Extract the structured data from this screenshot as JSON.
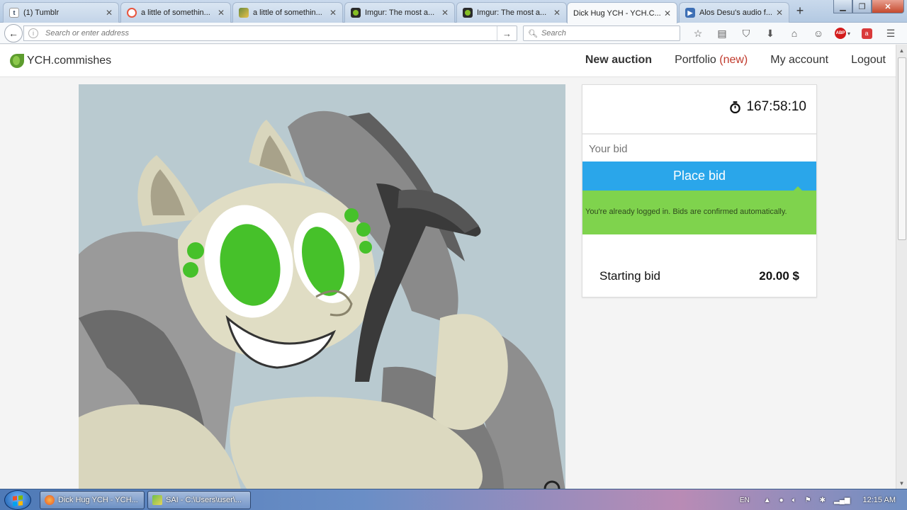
{
  "browser": {
    "tabs": [
      {
        "title": "(1) Tumblr",
        "icon": "tumblr-icon",
        "active": false
      },
      {
        "title": "a little of somethin...",
        "icon": "patreon-icon",
        "active": false
      },
      {
        "title": "a little of somethin...",
        "icon": "artwork-thumb-icon",
        "active": false
      },
      {
        "title": "Imgur: The most a...",
        "icon": "imgur-icon",
        "active": false
      },
      {
        "title": "Imgur: The most a...",
        "icon": "imgur-icon",
        "active": false
      },
      {
        "title": "Dick Hug YCH - YCH.C...",
        "icon": "none",
        "active": true
      },
      {
        "title": "Alos Desu's audio f...",
        "icon": "audio-play-icon",
        "active": false
      }
    ],
    "new_tab": "+",
    "address_placeholder": "Search or enter address",
    "search_placeholder": "Search"
  },
  "site": {
    "logo_text": "YCH.commishes",
    "nav": {
      "new_auction": "New auction",
      "portfolio": "Portfolio",
      "portfolio_badge": "(new)",
      "my_account": "My account",
      "logout": "Logout"
    }
  },
  "auction": {
    "timer": "167:58:10",
    "bid_placeholder": "Your bid",
    "place_bid": "Place bid",
    "notice": "You're already logged in. Bids are confirmed automatically.",
    "starting_bid_label": "Starting bid",
    "starting_bid_value": "20.00 $"
  },
  "taskbar": {
    "items": [
      {
        "label": "Dick Hug YCH - YCH...",
        "icon": "firefox-icon"
      },
      {
        "label": "SAI - C:\\Users\\user\\...",
        "icon": "sai-icon"
      }
    ],
    "language": "EN",
    "clock": "12:15 AM"
  },
  "colors": {
    "place_bid": "#2aa6ea",
    "notice_bg": "#7fd34d",
    "portfolio_new": "#c0392b"
  }
}
